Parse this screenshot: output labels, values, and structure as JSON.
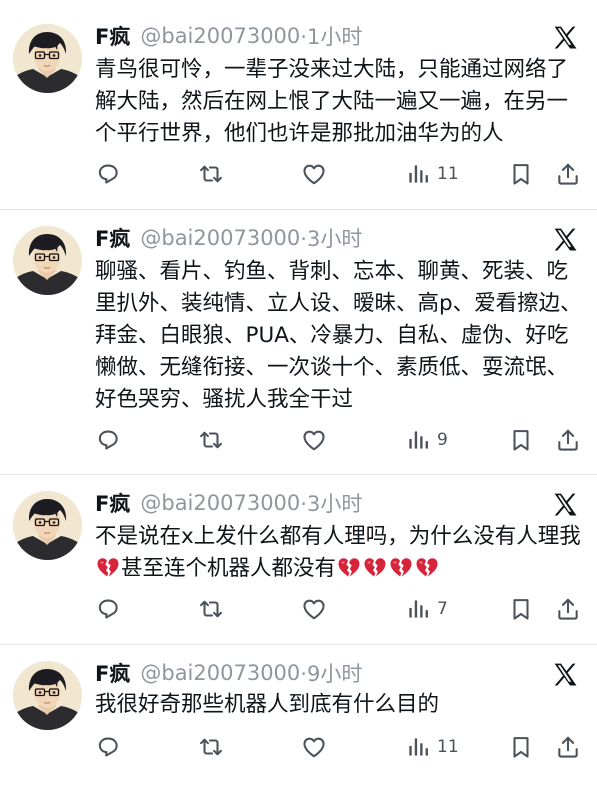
{
  "tweets": [
    {
      "name": "F疯",
      "handle": "@bai20073000",
      "time": "·1小时",
      "body": "青鸟很可怜，一辈子没来过大陆，只能通过网络了解大陆，然后在网上恨了大陆一遍又一遍，在另一个平行世界，他们也许是那批加油华为的人",
      "views": "11"
    },
    {
      "name": "F疯",
      "handle": "@bai20073000",
      "time": "·3小时",
      "body": "聊骚、看片、钓鱼、背刺、忘本、聊黄、死装、吃里扒外、装纯情、立人设、暧昧、高p、爱看擦边、拜金、白眼狼、PUA、冷暴力、自私、虚伪、好吃懒做、无缝衔接、一次谈十个、素质低、耍流氓、好色哭穷、骚扰人我全干过",
      "views": "9"
    },
    {
      "name": "F疯",
      "handle": "@bai20073000",
      "time": "·3小时",
      "body_part1": "不是说在x上发什么都有人理吗，为什么没有人理我",
      "body_part2": "甚至连个机器人都没有",
      "views": "7"
    },
    {
      "name": "F疯",
      "handle": "@bai20073000",
      "time": "·9小时",
      "body": "我很好奇那些机器人到底有什么目的",
      "views": "11"
    }
  ],
  "icons": {
    "reply": "reply-icon",
    "retweet": "retweet-icon",
    "like": "heart-icon",
    "views": "views-icon",
    "bookmark": "bookmark-icon",
    "share": "share-icon",
    "x": "x-logo-icon",
    "emoji": "broken-heart-emoji"
  },
  "colors": {
    "text": "#0f1419",
    "secondary": "#8f969d",
    "icon": "#4b5259",
    "divider": "#e6e6e6",
    "broken_heart": "#d8243a"
  }
}
